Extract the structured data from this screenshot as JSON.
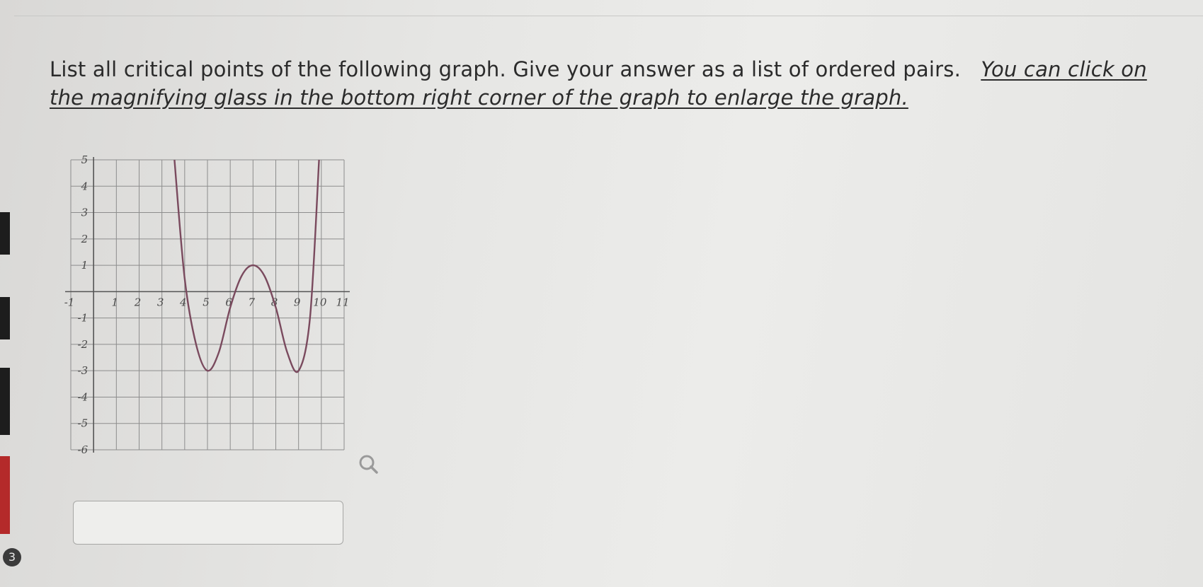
{
  "question": {
    "text": "List all critical points of the following graph. Give your answer as a list of ordered pairs.",
    "hint": "You can click on the magnifying glass in the bottom right corner of the graph to enlarge the graph."
  },
  "answer": {
    "value": ""
  },
  "sidebar": {
    "badge": "3"
  },
  "chart_data": {
    "type": "line",
    "x_ticks": [
      "-1",
      "1",
      "2",
      "3",
      "4",
      "5",
      "6",
      "7",
      "8",
      "9",
      "10",
      "11"
    ],
    "y_ticks": [
      "5",
      "4",
      "3",
      "2",
      "1",
      "-1",
      "-2",
      "-3",
      "-4",
      "-5",
      "-6"
    ],
    "xlim": [
      -1,
      11
    ],
    "ylim": [
      -6,
      5
    ],
    "grid": true,
    "series": [
      {
        "x": [
          3.55,
          4.0,
          4.5,
          5.0,
          5.5,
          6.0,
          6.5,
          7.0,
          7.5,
          8.0,
          8.5,
          9.0,
          9.5,
          9.9
        ],
        "y": [
          5.0,
          0.5,
          -2.0,
          -3.0,
          -2.3,
          -0.6,
          0.6,
          1.0,
          0.6,
          -0.6,
          -2.3,
          -3.0,
          -1.0,
          5.0
        ]
      }
    ],
    "line_color": "#7a4a5e",
    "grid_color": "#8d8d8d"
  }
}
